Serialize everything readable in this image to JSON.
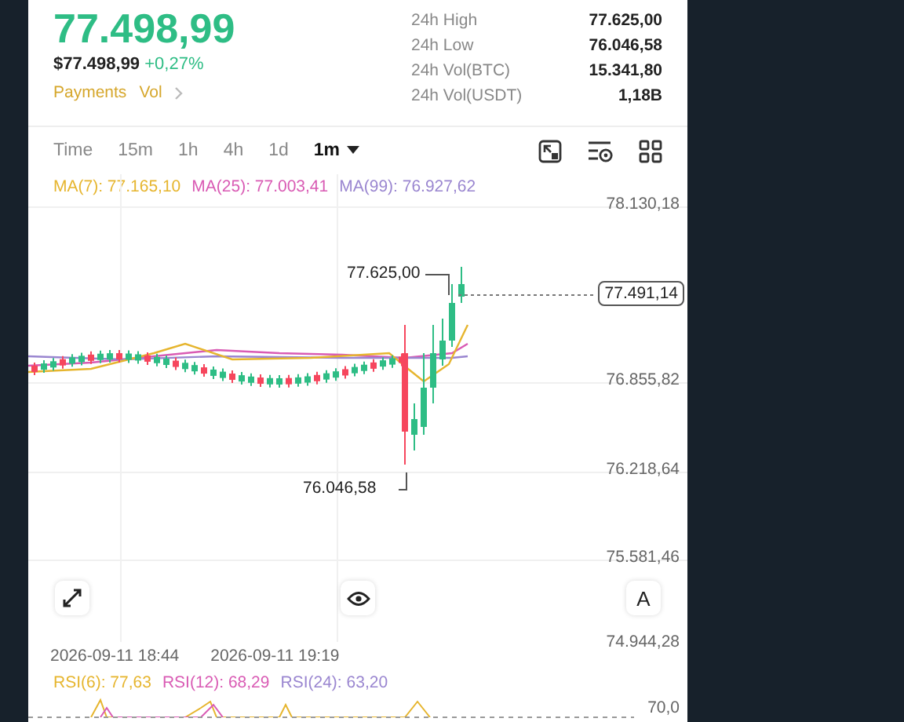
{
  "ticker": {
    "price": "77.498,99",
    "fiat_price": "$77.498,99",
    "change": "+0,27%",
    "tags": [
      "Payments",
      "Vol"
    ]
  },
  "stats": [
    {
      "label": "24h High",
      "value": "77.625,00"
    },
    {
      "label": "24h Low",
      "value": "76.046,58"
    },
    {
      "label": "24h Vol(BTC)",
      "value": "15.341,80"
    },
    {
      "label": "24h Vol(USDT)",
      "value": "1,18B"
    }
  ],
  "timeframes": [
    {
      "label": "Time",
      "selected": false
    },
    {
      "label": "15m",
      "selected": false
    },
    {
      "label": "1h",
      "selected": false
    },
    {
      "label": "4h",
      "selected": false
    },
    {
      "label": "1d",
      "selected": false
    },
    {
      "label": "1m",
      "selected": true
    }
  ],
  "ma_indicators": [
    {
      "label": "MA(7): 77.165,10",
      "color": "#e6b52e"
    },
    {
      "label": "MA(25): 77.003,41",
      "color": "#d95bb4"
    },
    {
      "label": "MA(99): 76.927,62",
      "color": "#9a86d0"
    }
  ],
  "chart": {
    "price_axis": [
      "78.130,18",
      "76.855,82",
      "76.218,64",
      "75.581,46",
      "74.944,28"
    ],
    "current_price": "77.491,14",
    "high_marker": "77.625,00",
    "low_marker": "76.046,58",
    "price_mode_button": "A"
  },
  "time_axis": [
    "2026-09-11 18:44",
    "2026-09-11 19:19"
  ],
  "rsi": {
    "indicators": [
      {
        "label": "RSI(6): 77,63",
        "color": "#e6b52e"
      },
      {
        "label": "RSI(12): 68,29",
        "color": "#d95bb4"
      },
      {
        "label": "RSI(24): 63,20",
        "color": "#9a86d0"
      }
    ],
    "level_label": "70,0"
  }
}
